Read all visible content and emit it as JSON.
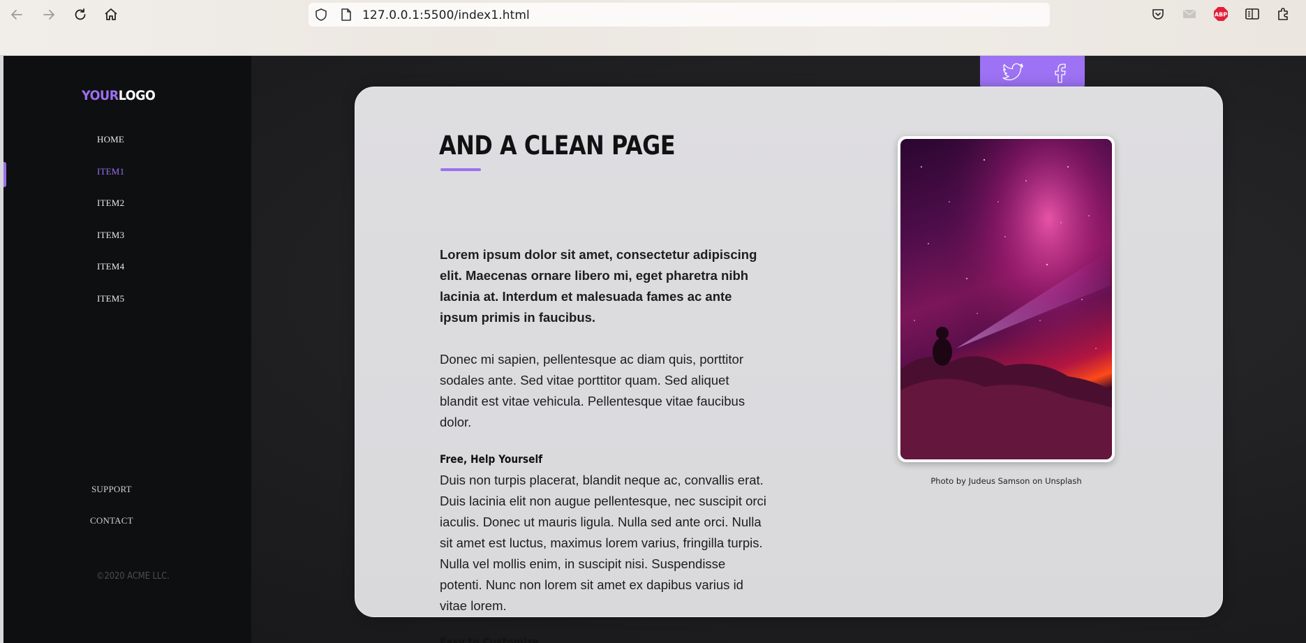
{
  "browser": {
    "url": "127.0.0.1:5500/index1.html"
  },
  "sidebar": {
    "logo": {
      "part1": "YOUR",
      "part2": "LOGO"
    },
    "nav": [
      {
        "label": "HOME"
      },
      {
        "label": "ITEM1",
        "active": true
      },
      {
        "label": "ITEM2"
      },
      {
        "label": "ITEM3"
      },
      {
        "label": "ITEM4"
      },
      {
        "label": "ITEM5"
      }
    ],
    "footer_links": [
      {
        "label": "SUPPORT"
      },
      {
        "label": "CONTACT"
      }
    ],
    "copyright": "©2020 ACME LLC."
  },
  "social": {
    "icons": [
      "twitter-icon",
      "facebook-icon"
    ]
  },
  "content": {
    "title": "AND A CLEAN PAGE",
    "lead": "Lorem ipsum dolor sit amet, consectetur adipiscing elit. Maecenas ornare libero mi, eget pharetra nibh lacinia at. Interdum et malesuada fames ac ante ipsum primis in faucibus.",
    "paragraph": "Donec mi sapien, pellentesque ac diam quis, porttitor sodales ante. Sed vitae porttitor quam. Sed aliquet blandit est vitae vehicula. Pellentesque vitae faucibus dolor.",
    "section1_heading": "Free, Help Yourself",
    "section1_text": "Duis non turpis placerat, blandit neque ac, convallis erat. Duis lacinia elit non augue pellentesque, nec suscipit orci iaculis. Donec ut mauris ligula. Nulla sed ante orci. Nulla sit amet est luctus, maximus lorem varius, fringilla turpis. Nulla vel mollis enim, in suscipit nisi. Suspendisse potenti. Nunc non lorem sit amet ex dapibus varius id vitae lorem.",
    "section2_heading": "Easy to Customize",
    "photo_caption": "Photo by Judeus Samson on Unsplash"
  },
  "colors": {
    "accent": "#9b6ff0",
    "sidebar_bg": "#0e0f11",
    "card_bg": "#dedde0"
  }
}
